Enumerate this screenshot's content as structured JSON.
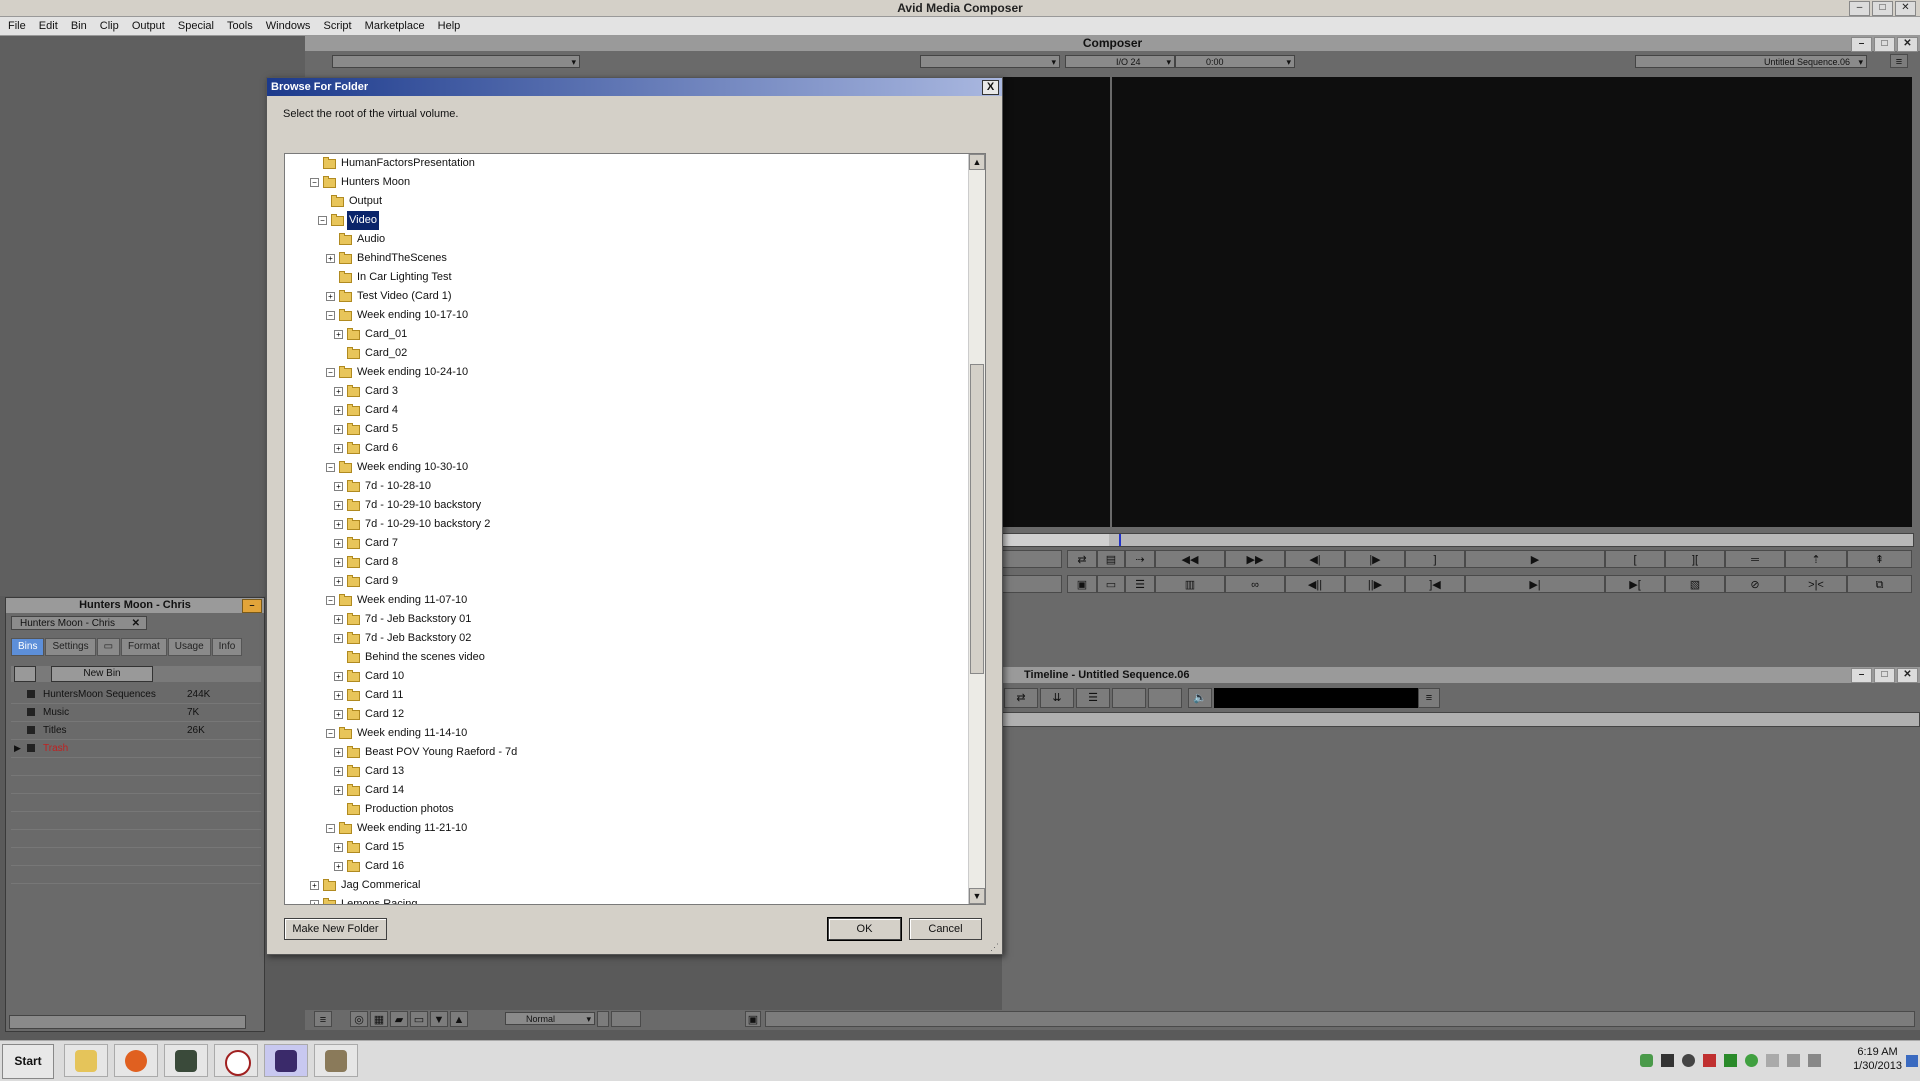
{
  "app": {
    "title": "Avid Media Composer"
  },
  "menu": [
    "File",
    "Edit",
    "Bin",
    "Clip",
    "Output",
    "Special",
    "Tools",
    "Windows",
    "Script",
    "Marketplace",
    "Help"
  ],
  "window_buttons": {
    "minimize": "–",
    "maximize": "□",
    "close": "✕"
  },
  "composer": {
    "title": "Composer",
    "timecode": "I/O 24",
    "duration": "0:00",
    "sequence": "Untitled Sequence.06"
  },
  "project": {
    "title": "Hunters Moon - Chris",
    "tab": "Hunters Moon - Chris",
    "tabs": [
      "Bins",
      "Settings",
      "",
      "Format",
      "Usage",
      "Info"
    ],
    "new_bin": "New Bin",
    "bins": [
      {
        "name": "HuntersMoon Sequences",
        "size": "244K"
      },
      {
        "name": "Music",
        "size": "7K"
      },
      {
        "name": "Titles",
        "size": "26K"
      },
      {
        "name": "Trash",
        "size": ""
      }
    ]
  },
  "timeline": {
    "title": "Timeline - Untitled Sequence.06"
  },
  "bottom_bar": {
    "mode": "Normal"
  },
  "dialog": {
    "title": "Browse For Folder",
    "close": "X",
    "prompt": "Select the root of the virtual volume.",
    "make_new_folder": "Make New Folder",
    "ok": "OK",
    "cancel": "Cancel",
    "tree": [
      {
        "label": "HumanFactorsPresentation",
        "level": 1,
        "toggle": ""
      },
      {
        "label": "Hunters Moon",
        "level": 1,
        "toggle": "-"
      },
      {
        "label": "Output",
        "level": 2,
        "toggle": ""
      },
      {
        "label": "Video",
        "level": 2,
        "toggle": "-",
        "selected": true
      },
      {
        "label": "Audio",
        "level": 3,
        "toggle": ""
      },
      {
        "label": "BehindTheScenes",
        "level": 3,
        "toggle": "+"
      },
      {
        "label": "In Car Lighting Test",
        "level": 3,
        "toggle": ""
      },
      {
        "label": "Test Video (Card 1)",
        "level": 3,
        "toggle": "+"
      },
      {
        "label": "Week ending 10-17-10",
        "level": 3,
        "toggle": "-"
      },
      {
        "label": "Card_01",
        "level": 4,
        "toggle": "+"
      },
      {
        "label": "Card_02",
        "level": 4,
        "toggle": ""
      },
      {
        "label": "Week ending 10-24-10",
        "level": 3,
        "toggle": "-"
      },
      {
        "label": "Card 3",
        "level": 4,
        "toggle": "+"
      },
      {
        "label": "Card 4",
        "level": 4,
        "toggle": "+"
      },
      {
        "label": "Card 5",
        "level": 4,
        "toggle": "+"
      },
      {
        "label": "Card 6",
        "level": 4,
        "toggle": "+"
      },
      {
        "label": "Week ending 10-30-10",
        "level": 3,
        "toggle": "-"
      },
      {
        "label": "7d - 10-28-10",
        "level": 4,
        "toggle": "+"
      },
      {
        "label": "7d - 10-29-10 backstory",
        "level": 4,
        "toggle": "+"
      },
      {
        "label": "7d - 10-29-10 backstory 2",
        "level": 4,
        "toggle": "+"
      },
      {
        "label": "Card 7",
        "level": 4,
        "toggle": "+"
      },
      {
        "label": "Card 8",
        "level": 4,
        "toggle": "+"
      },
      {
        "label": "Card 9",
        "level": 4,
        "toggle": "+"
      },
      {
        "label": "Week ending 11-07-10",
        "level": 3,
        "toggle": "-"
      },
      {
        "label": "7d - Jeb Backstory 01",
        "level": 4,
        "toggle": "+"
      },
      {
        "label": "7d - Jeb Backstory 02",
        "level": 4,
        "toggle": "+"
      },
      {
        "label": "Behind the scenes video",
        "level": 4,
        "toggle": ""
      },
      {
        "label": "Card 10",
        "level": 4,
        "toggle": "+"
      },
      {
        "label": "Card 11",
        "level": 4,
        "toggle": "+"
      },
      {
        "label": "Card 12",
        "level": 4,
        "toggle": "+"
      },
      {
        "label": "Week ending 11-14-10",
        "level": 3,
        "toggle": "-"
      },
      {
        "label": "Beast POV Young Raeford - 7d",
        "level": 4,
        "toggle": "+"
      },
      {
        "label": "Card 13",
        "level": 4,
        "toggle": "+"
      },
      {
        "label": "Card 14",
        "level": 4,
        "toggle": "+"
      },
      {
        "label": "Production photos",
        "level": 4,
        "toggle": ""
      },
      {
        "label": "Week ending 11-21-10",
        "level": 3,
        "toggle": "-"
      },
      {
        "label": "Card 15",
        "level": 4,
        "toggle": "+"
      },
      {
        "label": "Card 16",
        "level": 4,
        "toggle": "+"
      },
      {
        "label": "Jag Commerical",
        "level": 1,
        "toggle": "+"
      },
      {
        "label": "Lemons Racing",
        "level": 1,
        "toggle": "+"
      }
    ]
  },
  "taskbar": {
    "start": "Start",
    "time": "6:19 AM",
    "date": "1/30/2013"
  },
  "colors": {
    "dialog_title_start": "#1c3a8c",
    "selection": "#0a246a",
    "folder": "#e8c55a",
    "trash_text": "#c02020"
  }
}
